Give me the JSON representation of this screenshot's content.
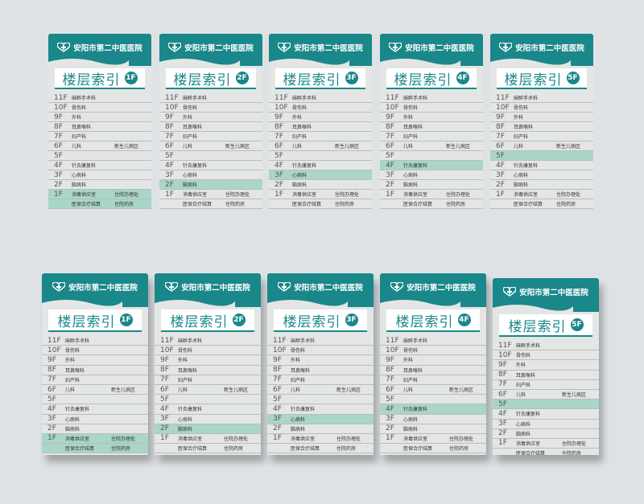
{
  "hospital_name": "安阳市第二中医医院",
  "index_title": "楼层索引",
  "colors": {
    "teal": "#1a878a",
    "highlight": "#a9d6c7",
    "panel": "#e4e6e5"
  },
  "panels": [
    {
      "floor_badge": "1F",
      "rows": [
        {
          "floor": "11F",
          "d1": "麻醉手术科",
          "d2": ""
        },
        {
          "floor": "10F",
          "d1": "骨伤科",
          "d2": ""
        },
        {
          "floor": "9F",
          "d1": "外科",
          "d2": ""
        },
        {
          "floor": "8F",
          "d1": "耳鼻喉科",
          "d2": ""
        },
        {
          "floor": "7F",
          "d1": "妇产科",
          "d2": ""
        },
        {
          "floor": "6F",
          "d1": "儿科",
          "d2": "新生儿病区"
        },
        {
          "floor": "5F",
          "d1": "",
          "d2": ""
        },
        {
          "floor": "4F",
          "d1": "针灸康复科",
          "d2": ""
        },
        {
          "floor": "3F",
          "d1": "心病科",
          "d2": ""
        },
        {
          "floor": "2F",
          "d1": "脑病科",
          "d2": ""
        },
        {
          "floor": "1F",
          "d1": "消毒供应室",
          "d2": "住院办理处"
        },
        {
          "floor": "",
          "d1": "医保合疗结算",
          "d2": "住院药房"
        }
      ]
    },
    {
      "floor_badge": "2F",
      "rows": [
        {
          "floor": "11F",
          "d1": "麻醉手术科",
          "d2": ""
        },
        {
          "floor": "10F",
          "d1": "骨伤科",
          "d2": ""
        },
        {
          "floor": "9F",
          "d1": "外科",
          "d2": ""
        },
        {
          "floor": "8F",
          "d1": "耳鼻喉科",
          "d2": ""
        },
        {
          "floor": "7F",
          "d1": "妇产科",
          "d2": ""
        },
        {
          "floor": "6F",
          "d1": "儿科",
          "d2": "新生儿病区"
        },
        {
          "floor": "5F",
          "d1": "",
          "d2": ""
        },
        {
          "floor": "4F",
          "d1": "针灸康复科",
          "d2": ""
        },
        {
          "floor": "3F",
          "d1": "心病科",
          "d2": ""
        },
        {
          "floor": "2F",
          "d1": "脑病科",
          "d2": ""
        },
        {
          "floor": "1F",
          "d1": "消毒供应室",
          "d2": "住院办理处"
        },
        {
          "floor": "",
          "d1": "医保合疗结算",
          "d2": "住院药房"
        }
      ]
    },
    {
      "floor_badge": "3F",
      "rows": [
        {
          "floor": "11F",
          "d1": "麻醉手术科",
          "d2": ""
        },
        {
          "floor": "10F",
          "d1": "骨伤科",
          "d2": ""
        },
        {
          "floor": "9F",
          "d1": "外科",
          "d2": ""
        },
        {
          "floor": "8F",
          "d1": "耳鼻喉科",
          "d2": ""
        },
        {
          "floor": "7F",
          "d1": "妇产科",
          "d2": ""
        },
        {
          "floor": "6F",
          "d1": "儿科",
          "d2": "新生儿病区"
        },
        {
          "floor": "5F",
          "d1": "",
          "d2": ""
        },
        {
          "floor": "4F",
          "d1": "针灸康复科",
          "d2": ""
        },
        {
          "floor": "3F",
          "d1": "心病科",
          "d2": ""
        },
        {
          "floor": "2F",
          "d1": "脑病科",
          "d2": ""
        },
        {
          "floor": "1F",
          "d1": "消毒供应室",
          "d2": "住院办理处"
        },
        {
          "floor": "",
          "d1": "医保合疗结算",
          "d2": "住院药房"
        }
      ]
    },
    {
      "floor_badge": "4F",
      "rows": [
        {
          "floor": "11F",
          "d1": "麻醉手术科",
          "d2": ""
        },
        {
          "floor": "10F",
          "d1": "骨伤科",
          "d2": ""
        },
        {
          "floor": "9F",
          "d1": "外科",
          "d2": ""
        },
        {
          "floor": "8F",
          "d1": "耳鼻喉科",
          "d2": ""
        },
        {
          "floor": "7F",
          "d1": "妇产科",
          "d2": ""
        },
        {
          "floor": "6F",
          "d1": "儿科",
          "d2": "新生儿病区"
        },
        {
          "floor": "5F",
          "d1": "",
          "d2": ""
        },
        {
          "floor": "4F",
          "d1": "针灸康复科",
          "d2": ""
        },
        {
          "floor": "3F",
          "d1": "心病科",
          "d2": ""
        },
        {
          "floor": "2F",
          "d1": "脑病科",
          "d2": ""
        },
        {
          "floor": "1F",
          "d1": "消毒供应室",
          "d2": "住院办理处"
        },
        {
          "floor": "",
          "d1": "医保合疗结算",
          "d2": "住院药房"
        }
      ]
    },
    {
      "floor_badge": "5F",
      "rows": [
        {
          "floor": "11F",
          "d1": "麻醉手术科",
          "d2": ""
        },
        {
          "floor": "10F",
          "d1": "骨伤科",
          "d2": ""
        },
        {
          "floor": "9F",
          "d1": "外科",
          "d2": ""
        },
        {
          "floor": "8F",
          "d1": "耳鼻喉科",
          "d2": ""
        },
        {
          "floor": "7F",
          "d1": "妇产科",
          "d2": ""
        },
        {
          "floor": "6F",
          "d1": "儿科",
          "d2": "新生儿病区"
        },
        {
          "floor": "5F",
          "d1": "",
          "d2": ""
        },
        {
          "floor": "4F",
          "d1": "针灸康复科",
          "d2": ""
        },
        {
          "floor": "3F",
          "d1": "心病科",
          "d2": ""
        },
        {
          "floor": "2F",
          "d1": "脑病科",
          "d2": ""
        },
        {
          "floor": "1F",
          "d1": "消毒供应室",
          "d2": "住院办理处"
        },
        {
          "floor": "",
          "d1": "医保合疗结算",
          "d2": "住院药房"
        }
      ]
    }
  ]
}
